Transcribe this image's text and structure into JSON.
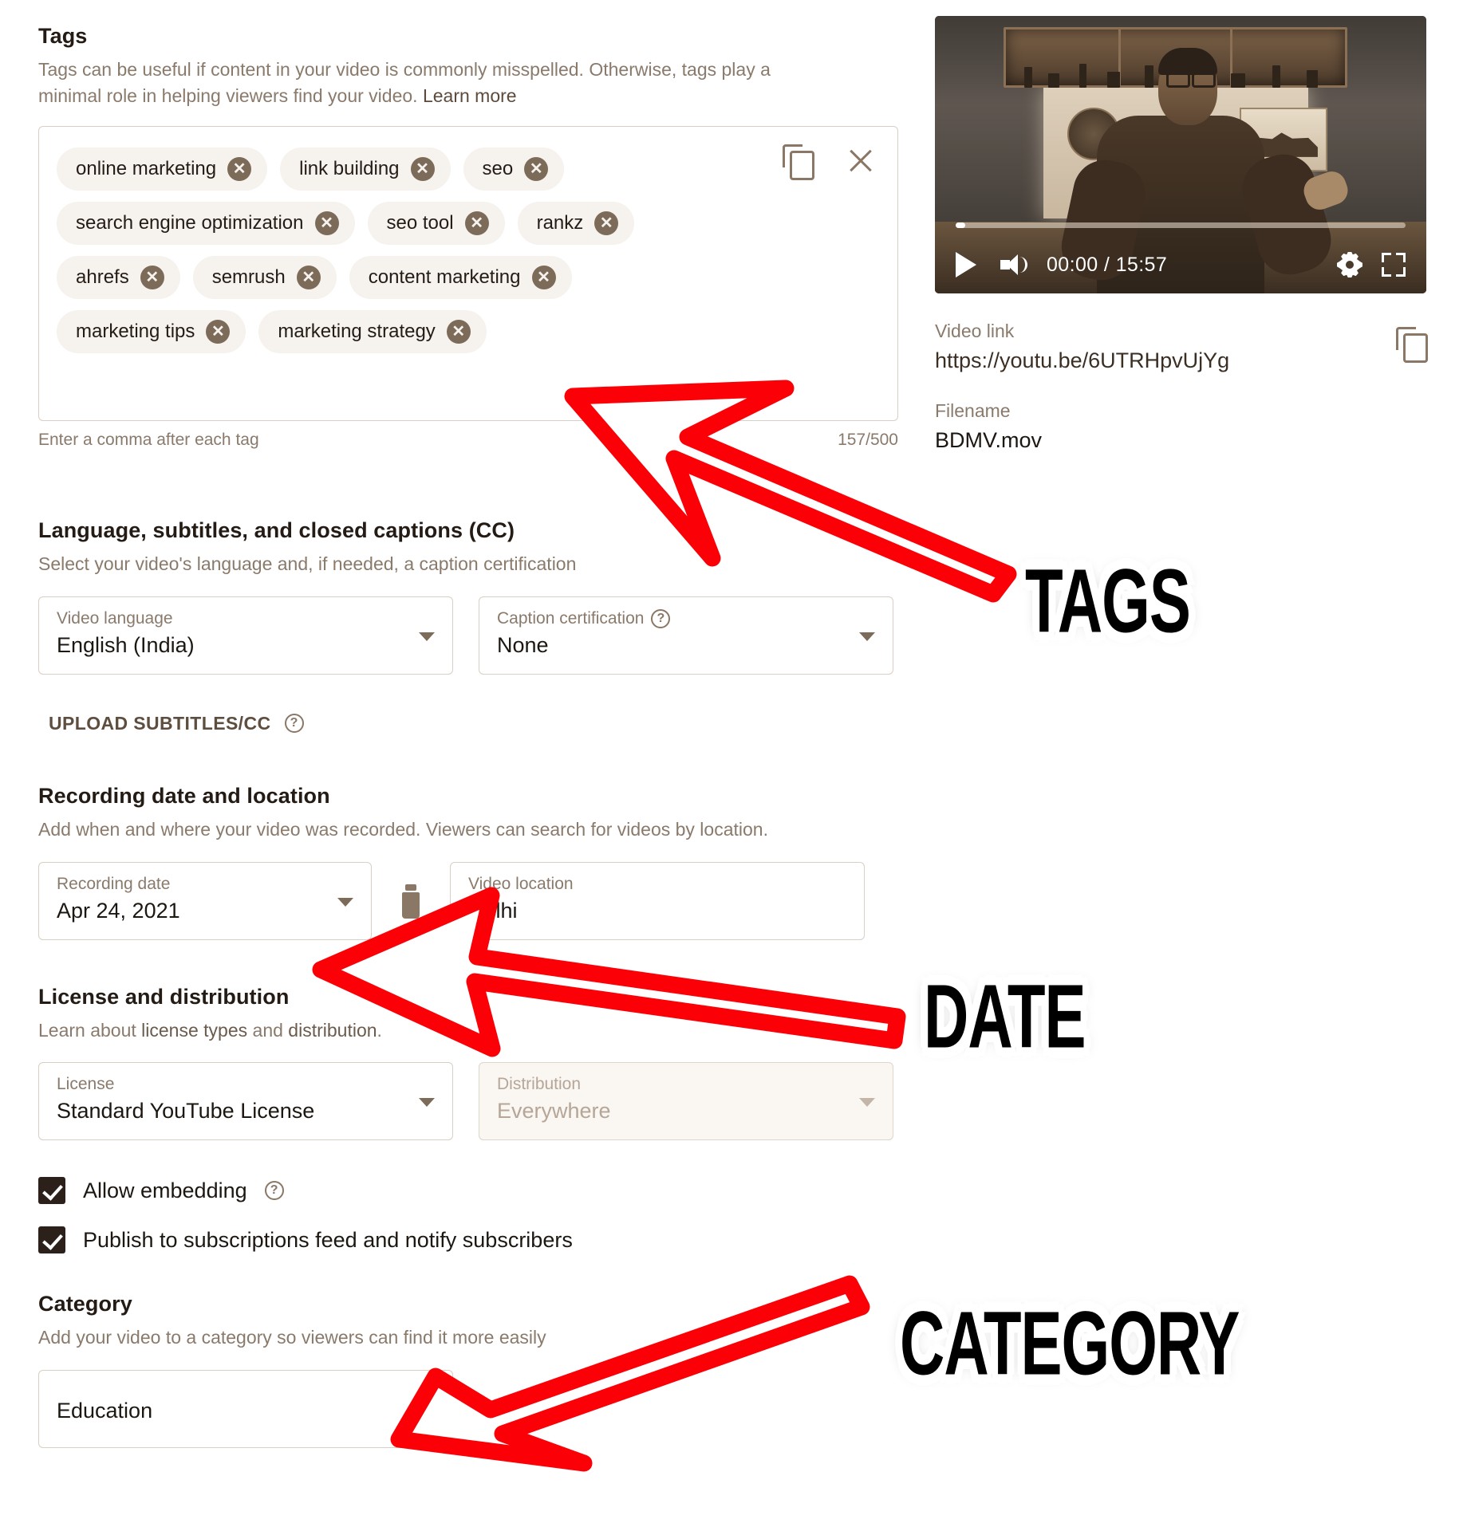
{
  "tags_section": {
    "title": "Tags",
    "description_line1": "Tags can be useful if content in your video is commonly misspelled. Otherwise, tags play a",
    "description_line2": "minimal role in helping viewers find your video.",
    "learn_more": "Learn more",
    "tags": [
      "online marketing",
      "link building",
      "seo",
      "search engine optimization",
      "seo tool",
      "rankz",
      "ahrefs",
      "semrush",
      "content marketing",
      "marketing tips",
      "marketing strategy"
    ],
    "hint": "Enter a comma after each tag",
    "counter": "157/500",
    "copy_icon": "copy-icon",
    "close_icon": "close-icon"
  },
  "language_section": {
    "title": "Language, subtitles, and closed captions (CC)",
    "description": "Select your video's language and, if needed, a caption certification",
    "video_language": {
      "label": "Video language",
      "value": "English (India)"
    },
    "caption_certification": {
      "label": "Caption certification",
      "value": "None",
      "help_icon": "help-icon"
    },
    "upload_subtitles_button": "UPLOAD SUBTITLES/CC"
  },
  "recording_section": {
    "title": "Recording date and location",
    "description": "Add when and where your video was recorded. Viewers can search for videos by location.",
    "recording_date": {
      "label": "Recording date",
      "value": "Apr 24, 2021"
    },
    "video_location": {
      "label": "Video location",
      "value": "Delhi"
    },
    "delete_icon": "trash-icon"
  },
  "license_section": {
    "title": "License and distribution",
    "description_prefix": "Learn about ",
    "description_link1": "license types",
    "description_middle": " and ",
    "description_link2": "distribution",
    "description_suffix": ".",
    "license": {
      "label": "License",
      "value": "Standard YouTube License"
    },
    "distribution": {
      "label": "Distribution",
      "value": "Everywhere"
    },
    "checkboxes": [
      {
        "label": "Allow embedding",
        "checked": true,
        "help_icon": "help-icon"
      },
      {
        "label": "Publish to subscriptions feed and notify subscribers",
        "checked": true
      }
    ]
  },
  "category_section": {
    "title": "Category",
    "description": "Add your video to a category so viewers can find it more easily",
    "category": {
      "value": "Education"
    }
  },
  "preview": {
    "player": {
      "play_icon": "play-icon",
      "volume_icon": "volume-icon",
      "time": "00:00 / 15:57",
      "settings_icon": "gear-icon",
      "fullscreen_icon": "fullscreen-icon"
    },
    "video_link": {
      "label": "Video link",
      "value": "https://youtu.be/6UTRHpvUjYg"
    },
    "filename": {
      "label": "Filename",
      "value": "BDMV.mov"
    },
    "copy_icon": "copy-icon"
  },
  "annotations": {
    "tags_label": "TAGS",
    "date_label": "DATE",
    "category_label": "CATEGORY",
    "arrow_color": "#FB0007"
  }
}
